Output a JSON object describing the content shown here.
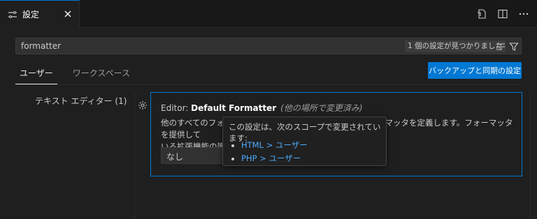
{
  "tab": {
    "title": "設定"
  },
  "search": {
    "value": "formatter",
    "result_count": "1 個の設定が見つかりました"
  },
  "scope_tabs": [
    {
      "label": "ユーザー",
      "active": true
    },
    {
      "label": "ワークスペース",
      "active": false
    }
  ],
  "sync_button": {
    "label": "バックアップと同期の設定"
  },
  "toc": {
    "item": "テキスト エディター (1)"
  },
  "setting": {
    "category": "Editor: ",
    "name": "Default Formatter",
    "modified_note": "(他の場所で変更済み)",
    "description_line1": "他のすべてのフォーマッタ設定よりも優先される既定のフォーマッタを定義します。フォーマッタを提供して",
    "description_line2": "いる拡張機能の識別子である必要があります。",
    "select_value": "なし"
  },
  "tooltip": {
    "title": "この設定は、次のスコープで変更されています:",
    "items": [
      "HTML > ユーザー",
      "PHP > ユーザー"
    ]
  },
  "colors": {
    "accent": "#0078d4",
    "link": "#4daafc",
    "background": "#1f1f1f"
  },
  "icons": [
    "settings-tab-icon",
    "close-icon",
    "open-json-icon",
    "split-editor-icon",
    "more-actions-icon",
    "clear-filter-icon",
    "filter-icon",
    "gear-icon"
  ]
}
